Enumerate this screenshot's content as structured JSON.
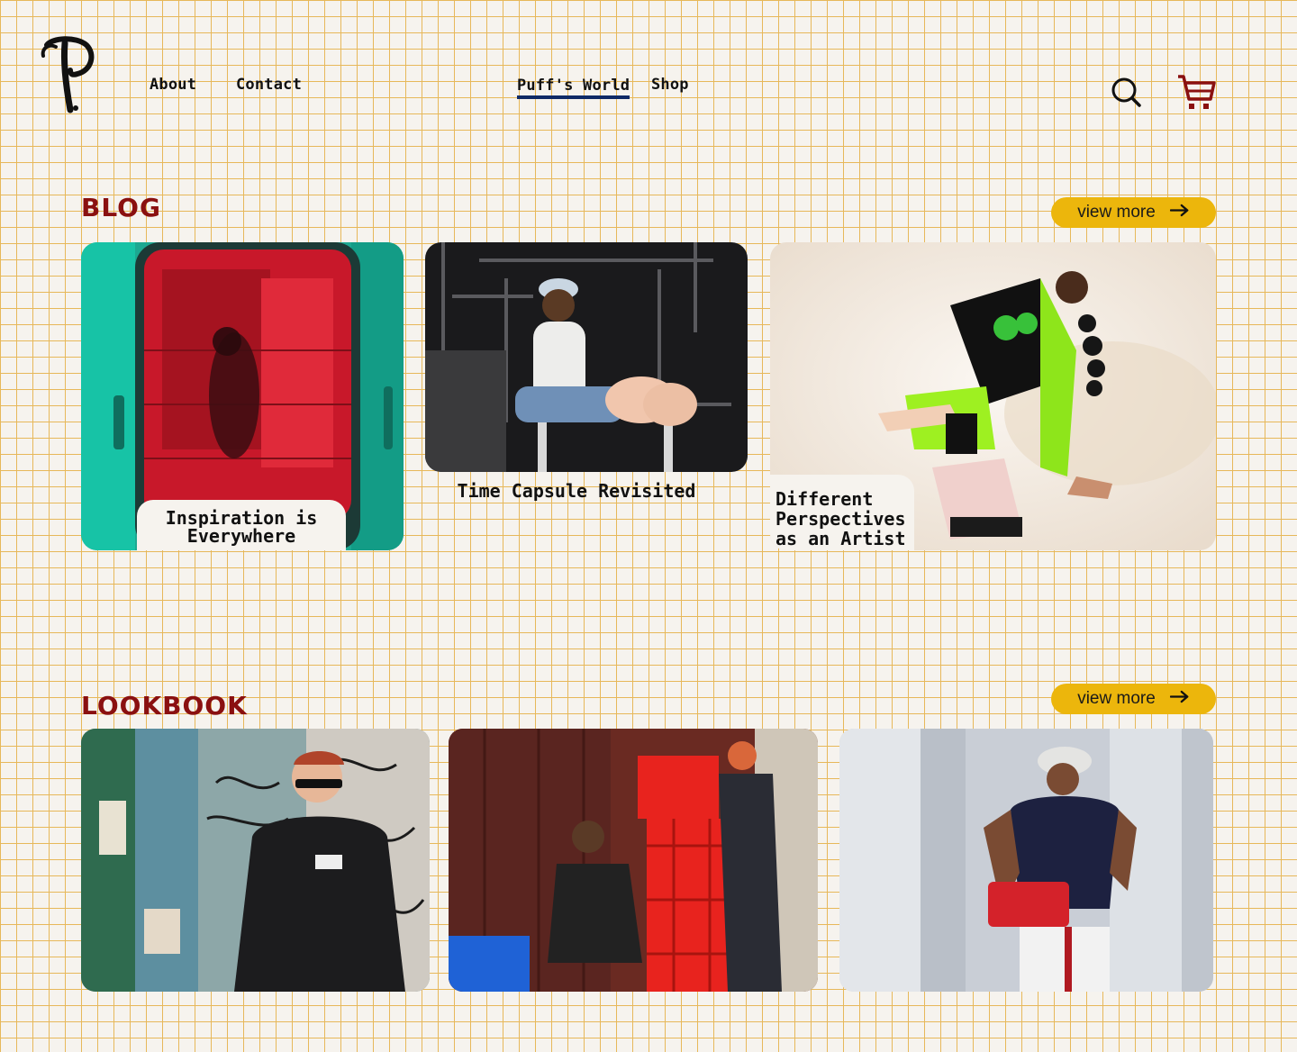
{
  "nav": {
    "left": [
      "About",
      "Contact"
    ],
    "center": [
      "Puff's World",
      "Shop"
    ],
    "icons": [
      "search-icon",
      "cart-icon"
    ]
  },
  "colors": {
    "accent": "#8a1010",
    "button": "#ecb60c",
    "grid": "#e7b85a",
    "active_underline": "#0f2a66"
  },
  "blog": {
    "title": "BLOG",
    "view_more": "view more",
    "posts": [
      {
        "title": "Inspiration is Everywhere"
      },
      {
        "title": "Time Capsule Revisited"
      },
      {
        "title": "Different Perspectives as an Artist"
      }
    ]
  },
  "lookbook": {
    "title": "LOOKBOOK",
    "view_more": "view more"
  }
}
